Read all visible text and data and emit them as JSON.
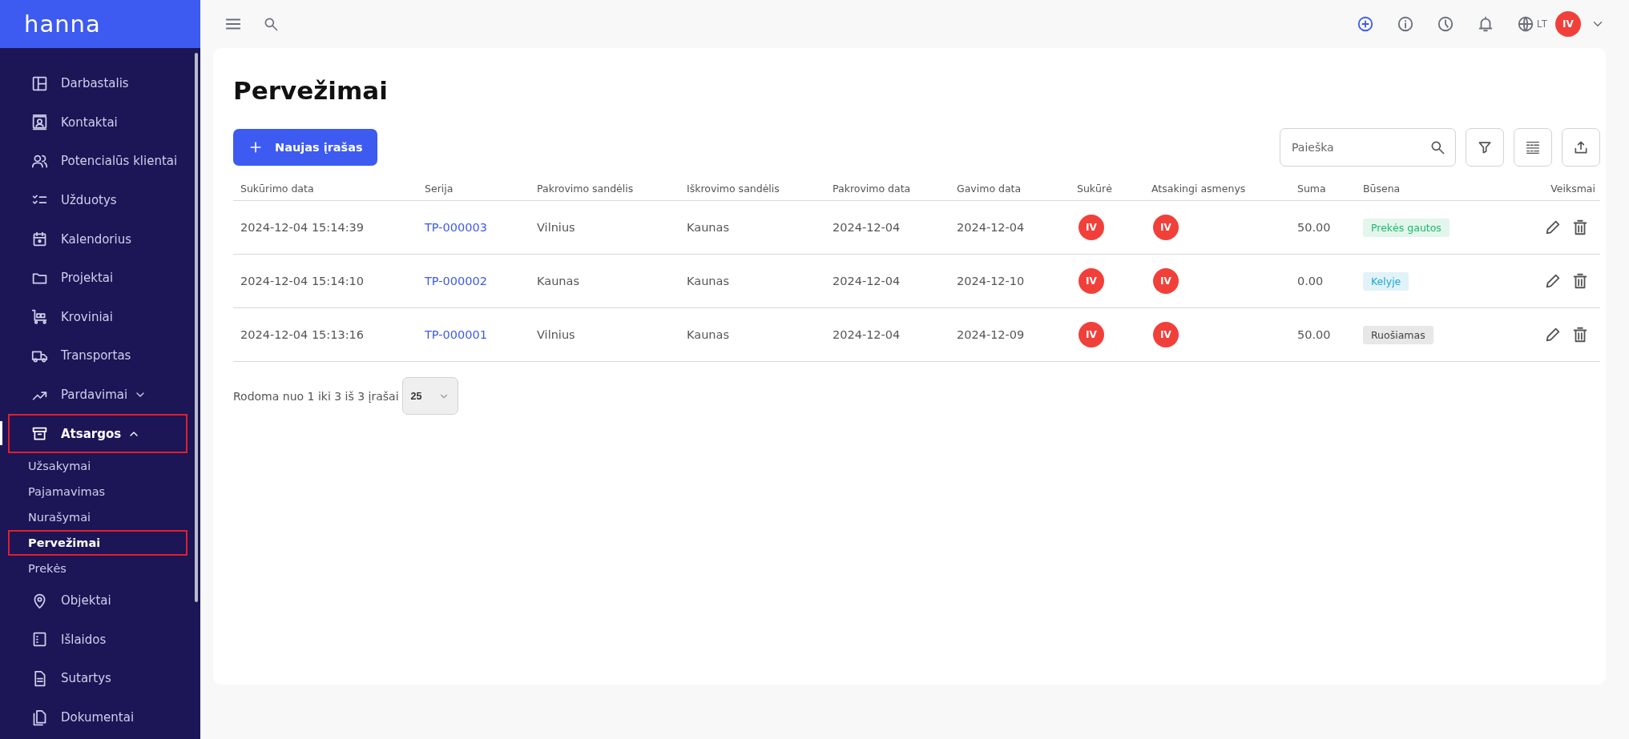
{
  "brand": "hanna",
  "sidebar": {
    "items": [
      {
        "kind": "link",
        "label": "Darbastalis",
        "selected": false,
        "highlighted": false
      },
      {
        "kind": "link",
        "label": "Kontaktai",
        "selected": false,
        "highlighted": false
      },
      {
        "kind": "link",
        "label": "Potencialūs klientai",
        "selected": false,
        "highlighted": false
      },
      {
        "kind": "link",
        "label": "Užduotys",
        "selected": false,
        "highlighted": false
      },
      {
        "kind": "link",
        "label": "Kalendorius",
        "selected": false,
        "highlighted": false
      },
      {
        "kind": "link",
        "label": "Projektai",
        "selected": false,
        "highlighted": false
      },
      {
        "kind": "link",
        "label": "Kroviniai",
        "selected": false,
        "highlighted": false
      },
      {
        "kind": "link",
        "label": "Transportas",
        "selected": false,
        "highlighted": false
      },
      {
        "kind": "group",
        "label": "Pardavimai",
        "selected": false,
        "highlighted": false,
        "expanded": false
      },
      {
        "kind": "group",
        "label": "Atsargos",
        "selected": true,
        "highlighted": true,
        "expanded": true,
        "children": [
          {
            "label": "Užsakymai",
            "selected": false,
            "highlighted": false
          },
          {
            "label": "Pajamavimas",
            "selected": false,
            "highlighted": false
          },
          {
            "label": "Nurašymai",
            "selected": false,
            "highlighted": false
          },
          {
            "label": "Pervežimai",
            "selected": true,
            "highlighted": true
          },
          {
            "label": "Prekės",
            "selected": false,
            "highlighted": false
          }
        ]
      },
      {
        "kind": "link",
        "label": "Objektai",
        "selected": false,
        "highlighted": false
      },
      {
        "kind": "link",
        "label": "Išlaidos",
        "selected": false,
        "highlighted": false
      },
      {
        "kind": "link",
        "label": "Sutartys",
        "selected": false,
        "highlighted": false
      },
      {
        "kind": "link",
        "label": "Dokumentai",
        "selected": false,
        "highlighted": false
      }
    ]
  },
  "topbar": {
    "language": "LT",
    "user_initials": "IV"
  },
  "page": {
    "title": "Pervežimai",
    "new_button": "Naujas įrašas",
    "search": {
      "placeholder": "Paieška"
    }
  },
  "table": {
    "columns": [
      "Sukūrimo data",
      "Serija",
      "Pakrovimo sandėlis",
      "Iškrovimo sandėlis",
      "Pakrovimo data",
      "Gavimo data",
      "Sukūrė",
      "Atsakingi asmenys",
      "Suma",
      "Būsena",
      "Veiksmai"
    ],
    "rows": [
      {
        "created": "2024-12-04 15:14:39",
        "series": "TP-000003",
        "load_warehouse": "Vilnius",
        "unload_warehouse": "Kaunas",
        "load_date": "2024-12-04",
        "receive_date": "2024-12-04",
        "creator": "IV",
        "responsible": "IV",
        "sum": "50.00",
        "status": {
          "label": "Prekės gautos",
          "color": "#1db96a"
        }
      },
      {
        "created": "2024-12-04 15:14:10",
        "series": "TP-000002",
        "load_warehouse": "Kaunas",
        "unload_warehouse": "Kaunas",
        "load_date": "2024-12-04",
        "receive_date": "2024-12-10",
        "creator": "IV",
        "responsible": "IV",
        "sum": "0.00",
        "status": {
          "label": "Kelyje",
          "color": "#1ba6d4"
        }
      },
      {
        "created": "2024-12-04 15:13:16",
        "series": "TP-000001",
        "load_warehouse": "Vilnius",
        "unload_warehouse": "Kaunas",
        "load_date": "2024-12-04",
        "receive_date": "2024-12-09",
        "creator": "IV",
        "responsible": "IV",
        "sum": "50.00",
        "status": {
          "label": "Ruošiamas",
          "color": "#444444"
        }
      }
    ]
  },
  "pagination": {
    "summary": "Rodoma nuo 1 iki 3 iš 3 įrašai",
    "page_size": "25"
  }
}
